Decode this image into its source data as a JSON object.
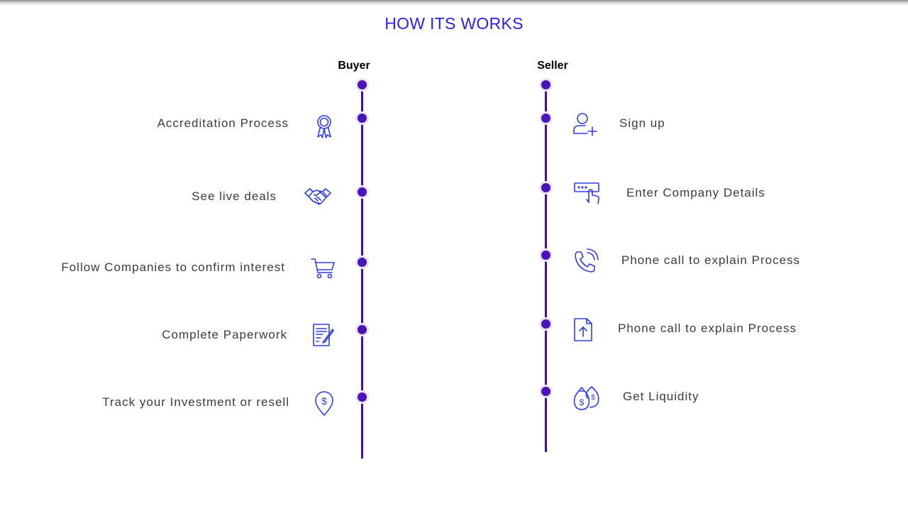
{
  "title": "HOW ITS WORKS",
  "accent_color": "#2a22e0",
  "timeline_color": "#3b0fa8",
  "icon_color": "#2f3ee6",
  "buyer": {
    "heading": "Buyer",
    "steps": [
      {
        "label": "Accreditation Process",
        "icon": "award-ribbon-icon"
      },
      {
        "label": "See live deals",
        "icon": "handshake-icon"
      },
      {
        "label": "Follow Companies to confirm interest",
        "icon": "shopping-cart-icon"
      },
      {
        "label": "Complete Paperwork",
        "icon": "document-edit-icon"
      },
      {
        "label": "Track your Investment or resell",
        "icon": "dollar-location-pin-icon"
      }
    ]
  },
  "seller": {
    "heading": "Seller",
    "steps": [
      {
        "label": "Sign up",
        "icon": "add-user-icon"
      },
      {
        "label": "Enter Company Details",
        "icon": "password-input-icon"
      },
      {
        "label": "Phone call to explain Process",
        "icon": "phone-call-icon"
      },
      {
        "label": "Phone call to explain Process",
        "icon": "file-upload-icon"
      },
      {
        "label": "Get Liquidity",
        "icon": "money-bags-icon"
      }
    ]
  }
}
